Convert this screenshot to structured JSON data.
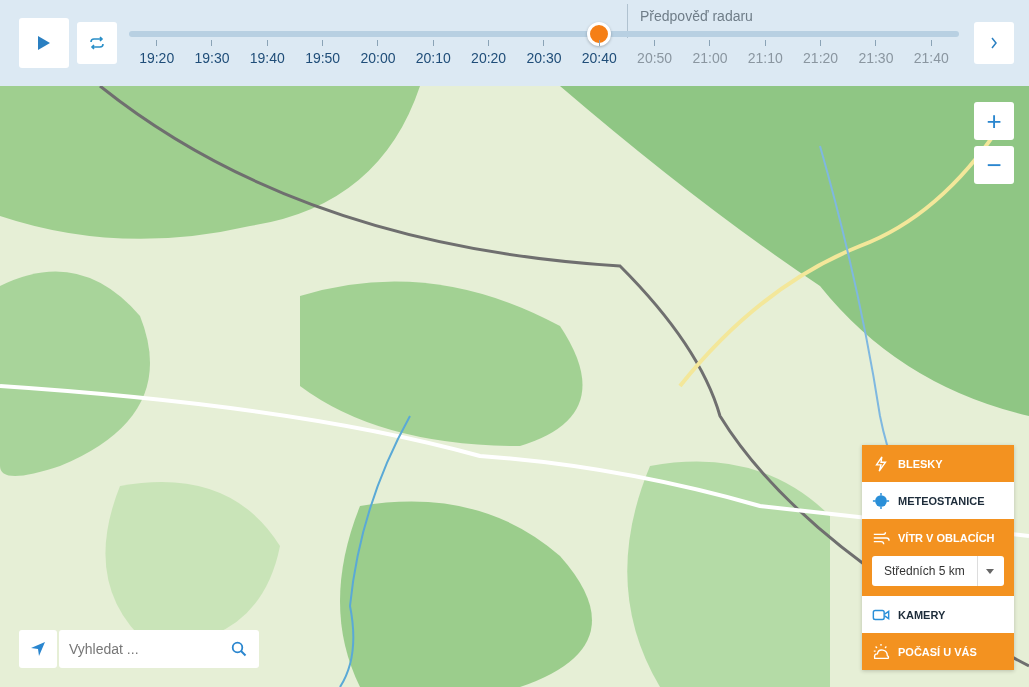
{
  "timeline": {
    "forecast_label": "Předpověď radaru",
    "level": 0.566,
    "times": [
      {
        "label": "19:20",
        "forecast": false
      },
      {
        "label": "19:30",
        "forecast": false
      },
      {
        "label": "19:40",
        "forecast": false
      },
      {
        "label": "19:50",
        "forecast": false
      },
      {
        "label": "20:00",
        "forecast": false
      },
      {
        "label": "20:10",
        "forecast": false
      },
      {
        "label": "20:20",
        "forecast": false
      },
      {
        "label": "20:30",
        "forecast": false
      },
      {
        "label": "20:40",
        "forecast": false
      },
      {
        "label": "20:50",
        "forecast": true
      },
      {
        "label": "21:00",
        "forecast": true
      },
      {
        "label": "21:10",
        "forecast": true
      },
      {
        "label": "21:20",
        "forecast": true
      },
      {
        "label": "21:30",
        "forecast": true
      },
      {
        "label": "21:40",
        "forecast": true
      }
    ]
  },
  "zoom": {
    "in": "+",
    "out": "−"
  },
  "layers": [
    {
      "kind": "lightning",
      "label": "BLESKY",
      "selected": true
    },
    {
      "kind": "station",
      "label": "METEOSTANICE",
      "selected": false
    },
    {
      "kind": "wind",
      "label": "VÍTR V OBLACÍCH",
      "selected": true,
      "dropdown": "Středních 5 km"
    },
    {
      "kind": "camera",
      "label": "KAMERY",
      "selected": false
    },
    {
      "kind": "weather",
      "label": "POČASÍ U VÁS",
      "selected": true
    }
  ],
  "search": {
    "placeholder": "Vyhledat ..."
  }
}
